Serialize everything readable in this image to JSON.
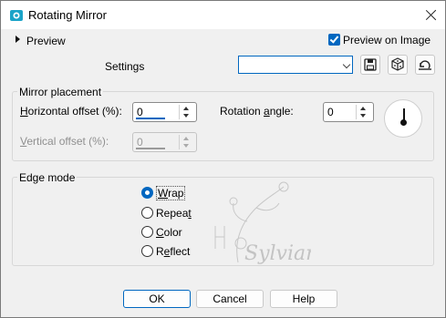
{
  "window": {
    "title": "Rotating Mirror"
  },
  "header": {
    "preview_toggle_label": "Preview",
    "preview_on_image_label": "Preview on Image",
    "preview_on_image_checked": true,
    "settings_label": "Settings",
    "settings_value": ""
  },
  "mirror_placement": {
    "group_label": "Mirror placement",
    "horizontal_offset": {
      "label": "Horizontal offset (%):",
      "value": "0",
      "enabled": true
    },
    "vertical_offset": {
      "label": "Vertical offset (%):",
      "value": "0",
      "enabled": false
    },
    "rotation_angle": {
      "label": "Rotation angle:",
      "value": "0"
    }
  },
  "edge_mode": {
    "group_label": "Edge mode",
    "options": [
      {
        "label": "Wrap",
        "selected": true
      },
      {
        "label": "Repeat",
        "selected": false
      },
      {
        "label": "Color",
        "selected": false
      },
      {
        "label": "Reflect",
        "selected": false
      }
    ]
  },
  "watermark": {
    "text": "Sylviane"
  },
  "footer": {
    "ok_label": "OK",
    "cancel_label": "Cancel",
    "help_label": "Help"
  },
  "colors": {
    "accent": "#0067c0",
    "background": "#f0f0f0"
  }
}
